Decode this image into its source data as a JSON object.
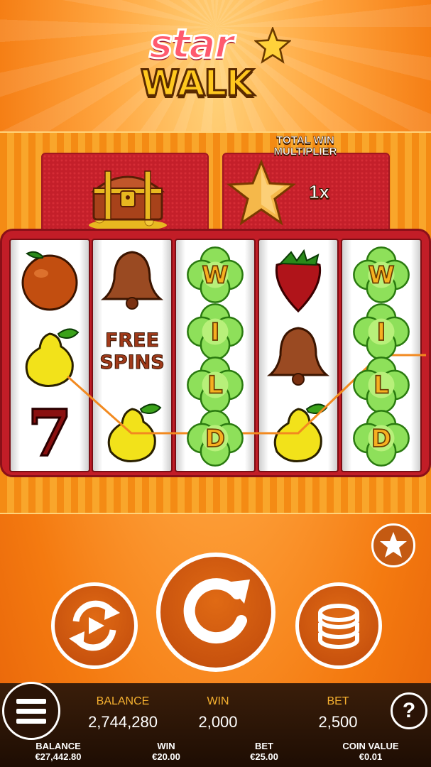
{
  "logo": {
    "line1": "star",
    "line2": "WALK"
  },
  "multiplier": {
    "title": "TOTAL WIN MULTIPLIER",
    "value": "1x"
  },
  "reels": [
    [
      "orange",
      "pear",
      "seven"
    ],
    [
      "bell",
      "free-spins",
      "pear"
    ],
    [
      "wild-w",
      "wild-i",
      "wild-l",
      "wild-d"
    ],
    [
      "strawberry",
      "bell",
      "pear"
    ],
    [
      "wild-w",
      "wild-i",
      "wild-l",
      "wild-d"
    ]
  ],
  "symbol_text": {
    "free_line1": "FREE",
    "free_line2": "SPINS",
    "wild": [
      "W",
      "I",
      "L",
      "D"
    ]
  },
  "stats": {
    "balance_label": "BALANCE",
    "balance_value": "2,744,280",
    "win_label": "WIN",
    "win_value": "2,000",
    "bet_label": "BET",
    "bet_value": "2,500"
  },
  "info": {
    "balance_label": "BALANCE",
    "balance_value": "€27,442.80",
    "win_label": "WIN",
    "win_value": "€20.00",
    "bet_label": "BET",
    "bet_value": "€25.00",
    "coin_label": "COIN VALUE",
    "coin_value": "€0.01"
  },
  "help_label": "?",
  "colors": {
    "accent": "#f47a10",
    "reel_frame": "#c21d27",
    "label": "#f6b130"
  }
}
